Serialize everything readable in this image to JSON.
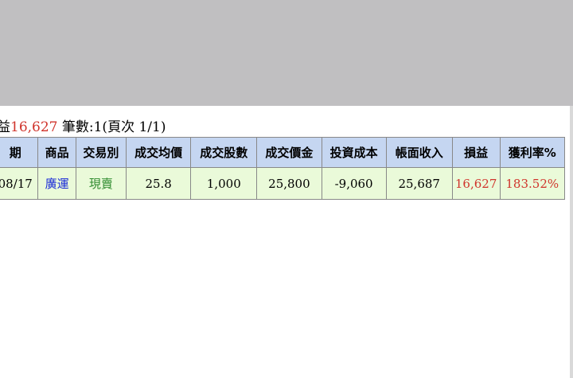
{
  "summary": {
    "label": "益",
    "profit": "16,627",
    "count_text": " 筆數:1(頁次 1/1)"
  },
  "columns": [
    "期",
    "商品",
    "交易別",
    "成交均價",
    "成交股數",
    "成交價金",
    "投資成本",
    "帳面收入",
    "損益",
    "獲利率%"
  ],
  "rows": [
    {
      "date": "08/17",
      "product": "廣運",
      "trade_type": "現賣",
      "avg_price": "25.8",
      "shares": "1,000",
      "amount": "25,800",
      "cost": "-9,060",
      "income": "25,687",
      "profit_loss": "16,627",
      "return_rate": "183.52%"
    }
  ],
  "colors": {
    "header_bg": "#c5d6f1",
    "row_bg": "#eafad9",
    "profit_red": "#d0342c",
    "product_blue": "#1a2bd8",
    "trade_green": "#2e8b2e",
    "top_gray": "#c0bfc1"
  }
}
